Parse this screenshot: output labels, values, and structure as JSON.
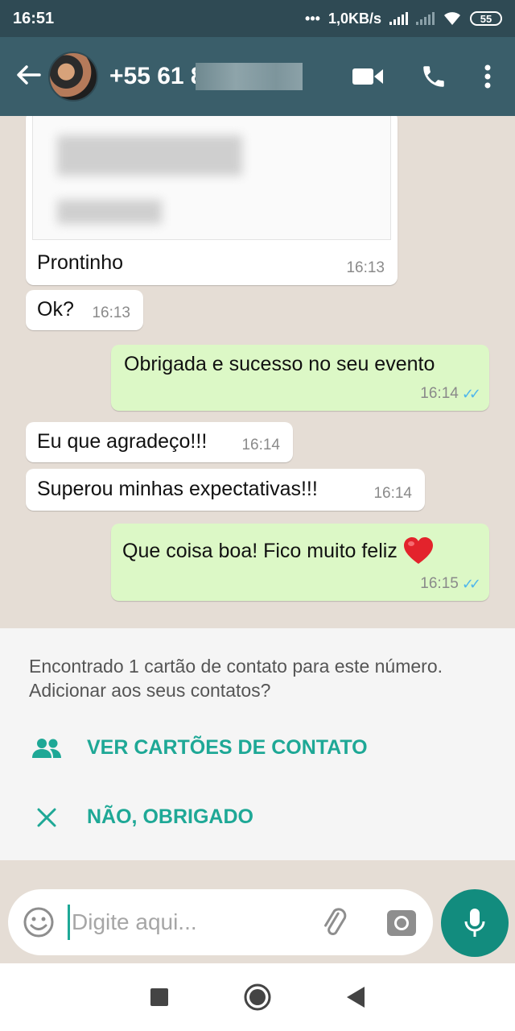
{
  "status_bar": {
    "time": "16:51",
    "dots": "•••",
    "network_speed": "1,0KB/s",
    "battery": "55"
  },
  "header": {
    "back_icon": "arrow-left-icon",
    "contact_number": "+55 61 8",
    "video_icon": "video-camera-icon",
    "call_icon": "phone-icon",
    "menu_icon": "more-vertical-icon"
  },
  "messages": [
    {
      "direction": "in",
      "text": "Prontinho",
      "time": "16:13",
      "has_attachment": true
    },
    {
      "direction": "in",
      "text": "Ok?",
      "time": "16:13"
    },
    {
      "direction": "out",
      "text": "Obrigada e sucesso no seu evento",
      "time": "16:14",
      "read": true
    },
    {
      "direction": "in",
      "text": "Eu que agradeço!!!",
      "time": "16:14"
    },
    {
      "direction": "in",
      "text": "Superou minhas expectativas!!!",
      "time": "16:14"
    },
    {
      "direction": "out",
      "text": "Que coisa boa! Fico muito feliz",
      "emoji": "❤️",
      "time": "16:15",
      "read": true
    }
  ],
  "contact_card_prompt": {
    "message": "Encontrado 1 cartão de contato para este número. Adicionar aos seus contatos?",
    "view_button": "VER CARTÕES DE CONTATO",
    "dismiss_button": "NÃO, OBRIGADO"
  },
  "composer": {
    "placeholder": "Digite aqui..."
  },
  "colors": {
    "status_bar": "#2f4a54",
    "app_bar": "#3a5e6a",
    "accent": "#1ea896",
    "mic_button": "#128c7e",
    "outgoing_bubble": "#dcf8c6",
    "read_ticks": "#4fb6ec"
  }
}
